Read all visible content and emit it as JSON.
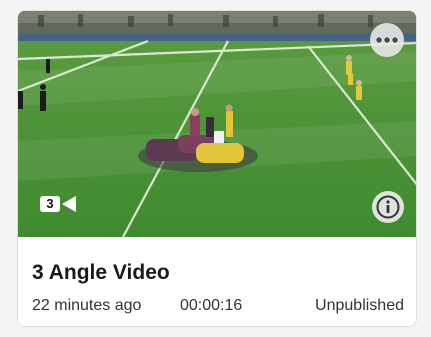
{
  "card": {
    "title": "3 Angle Video",
    "age": "22 minutes ago",
    "duration": "00:00:16",
    "status": "Unpublished",
    "angle_count": "3"
  },
  "icons": {
    "video_camera": "video-camera-icon",
    "more": "more-options-icon",
    "info": "info-icon"
  },
  "colors": {
    "pitch_green": "#4e9a3a",
    "text_primary": "#1a1a1a",
    "card_border": "#e0e0e0"
  }
}
